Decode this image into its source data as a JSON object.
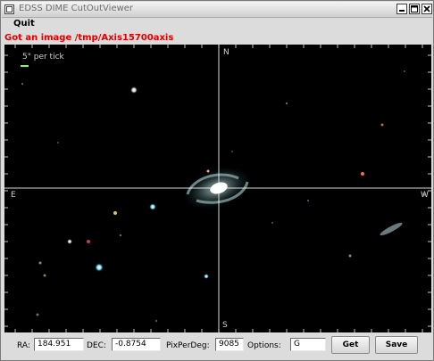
{
  "window": {
    "title": "EDSS DIME CutOutViewer"
  },
  "menu": {
    "quit_label": "Quit"
  },
  "status": {
    "message": "Got an image /tmp/Axis15700axis",
    "color": "#e00000"
  },
  "viewer": {
    "scale_label": "5\" per tick",
    "scale_bar_color": "#7fff3f",
    "directions": {
      "north": "N",
      "south": "S",
      "east": "E",
      "west": "W"
    },
    "crosshair_color": "#ffffff",
    "background_color": "#000000"
  },
  "controls": {
    "ra_label": "RA:",
    "ra_value": "184.951",
    "dec_label": "DEC:",
    "dec_value": "-0.8754",
    "pix_label": "PixPerDeg:",
    "pix_value": "9085",
    "options_label": "Options:",
    "options_value": "G",
    "get_label": "Get",
    "save_label": "Save"
  }
}
